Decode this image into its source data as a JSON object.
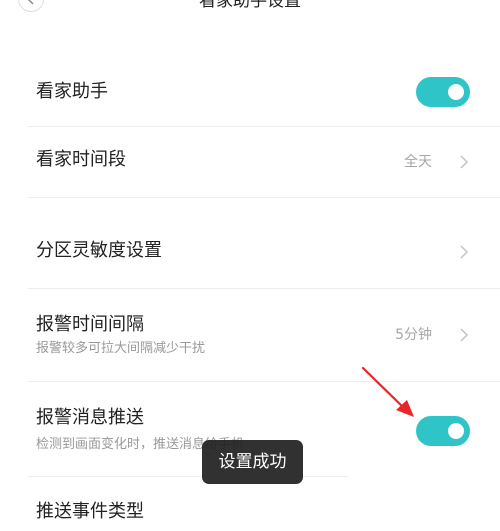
{
  "header": {
    "title": "看家助手设置",
    "back_icon": "chevron-left-icon"
  },
  "settings": {
    "home_guard": {
      "title": "看家助手",
      "toggle_on": true
    },
    "guard_period": {
      "title": "看家时间段",
      "value": "全天"
    },
    "zone_sensitivity": {
      "title": "分区灵敏度设置"
    },
    "alarm_interval": {
      "title": "报警时间间隔",
      "subtitle": "报警较多可拉大间隔减少干扰",
      "value": "5分钟"
    },
    "alarm_push": {
      "title": "报警消息推送",
      "subtitle": "检测到画面变化时，推送消息给手机",
      "toggle_on": true
    },
    "push_event_type": {
      "title": "推送事件类型"
    }
  },
  "toast": {
    "message": "设置成功"
  },
  "colors": {
    "accent": "#2ec4c8",
    "annotation": "#e8262a",
    "toast_bg": "#202020"
  }
}
